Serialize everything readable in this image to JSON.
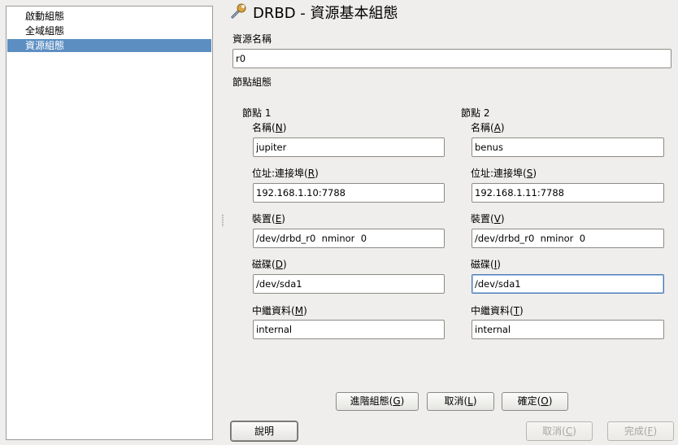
{
  "sidebar": {
    "items": [
      {
        "label": "啟動組態"
      },
      {
        "label": "全域組態"
      },
      {
        "label": "資源組態"
      }
    ]
  },
  "header": {
    "title": "DRBD - 資源基本組態",
    "icon": "wrench-icon"
  },
  "resource": {
    "name_label": "資源名稱",
    "name_value": "r0"
  },
  "nodes_section": {
    "label": "節點組態"
  },
  "node1": {
    "heading": "節點 1",
    "name_label": "名稱",
    "name_key": "N",
    "name_value": "jupiter",
    "address_label": "位址:連接埠",
    "address_key": "R",
    "address_value": "192.168.1.10:7788",
    "device_label": "裝置",
    "device_key": "E",
    "device_value": "/dev/drbd_r0  nminor  0",
    "disk_label": "磁碟",
    "disk_key": "D",
    "disk_value": "/dev/sda1",
    "meta_label": "中繼資料",
    "meta_key": "M",
    "meta_value": "internal"
  },
  "node2": {
    "heading": "節點 2",
    "name_label": "名稱",
    "name_key": "A",
    "name_value": "benus",
    "address_label": "位址:連接埠",
    "address_key": "S",
    "address_value": "192.168.1.11:7788",
    "device_label": "裝置",
    "device_key": "V",
    "device_value": "/dev/drbd_r0  nminor  0",
    "disk_label": "磁碟",
    "disk_key": "I",
    "disk_value": "/dev/sda1",
    "meta_label": "中繼資料",
    "meta_key": "T",
    "meta_value": "internal"
  },
  "actions": {
    "advanced_label": "進階組態",
    "advanced_key": "G",
    "cancel_label": "取消",
    "cancel_key": "L",
    "ok_label": "確定",
    "ok_key": "O"
  },
  "footer": {
    "help_label": "說明",
    "abort_label": "取消",
    "abort_key": "C",
    "finish_label": "完成",
    "finish_key": "F"
  },
  "colors": {
    "selection": "#5c8ec2",
    "background": "#efeeec",
    "focus_border": "#4a7ab8"
  }
}
